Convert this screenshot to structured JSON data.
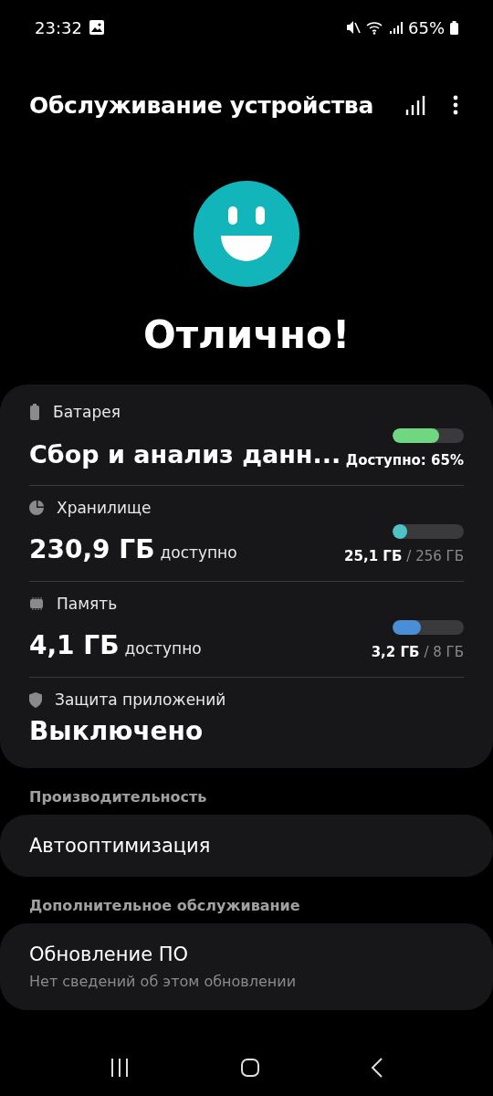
{
  "status_bar": {
    "time": "23:32",
    "battery": "65%"
  },
  "header": {
    "title": "Обслуживание устройства"
  },
  "status": {
    "text": "Отлично!"
  },
  "summary": [
    {
      "kind": "battery",
      "label": "Батарея",
      "value": "Сбор и анализ данн...",
      "reading": "Доступно: 65%",
      "level": 0.65,
      "color": "#6ed77f"
    },
    {
      "kind": "storage",
      "label": "Хранилище",
      "value": "230,9 ГБ",
      "unit": "доступно",
      "used": "25,1 ГБ",
      "total": "/ 256 ГБ",
      "level": 0.1,
      "color": "#4fc2c8"
    },
    {
      "kind": "memory",
      "label": "Память",
      "value": "4,1 ГБ",
      "unit": "доступно",
      "used": "3,2 ГБ",
      "total": "/ 8 ГБ",
      "level": 0.4,
      "color": "#4a8ed8"
    },
    {
      "kind": "security",
      "label": "Защита приложений",
      "value": "Выключено"
    }
  ],
  "sections": [
    {
      "title": "Производительность",
      "items": [
        {
          "title": "Автооптимизация"
        }
      ]
    },
    {
      "title": "Дополнительное обслуживание",
      "items": [
        {
          "title": "Обновление ПО",
          "subtitle": "Нет сведений об этом обновлении"
        }
      ]
    }
  ]
}
